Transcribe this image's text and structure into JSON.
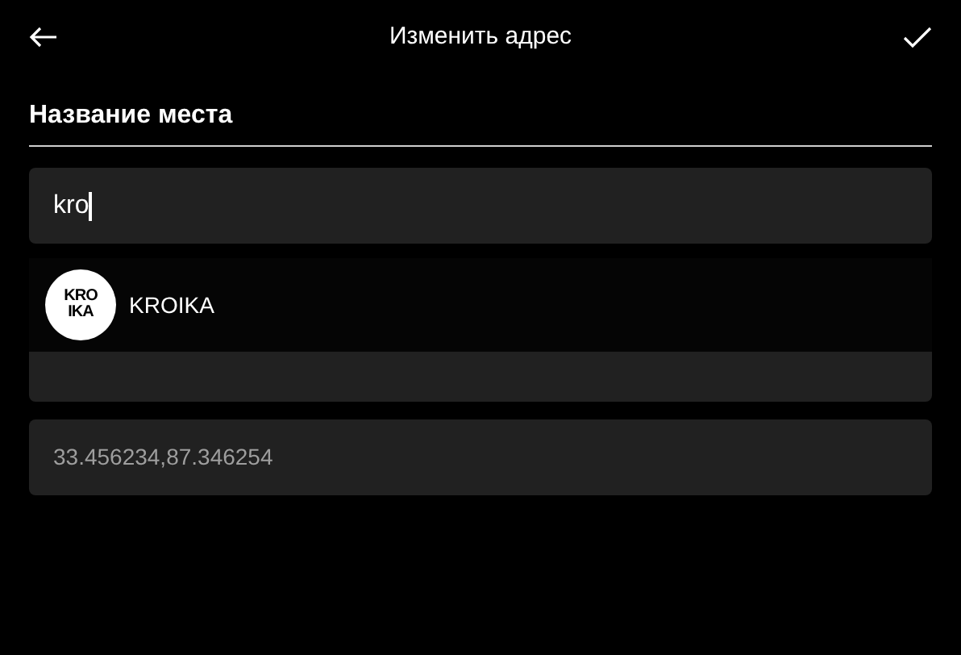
{
  "header": {
    "title": "Изменить адрес"
  },
  "section": {
    "title": "Название места"
  },
  "name_field": {
    "value": "kro",
    "focused": true
  },
  "suggestions": [
    {
      "logo_lines": [
        "KRO",
        "IKA"
      ],
      "label": "KROIKA"
    }
  ],
  "coordinates_field": {
    "value": "33.456234,87.346254"
  }
}
